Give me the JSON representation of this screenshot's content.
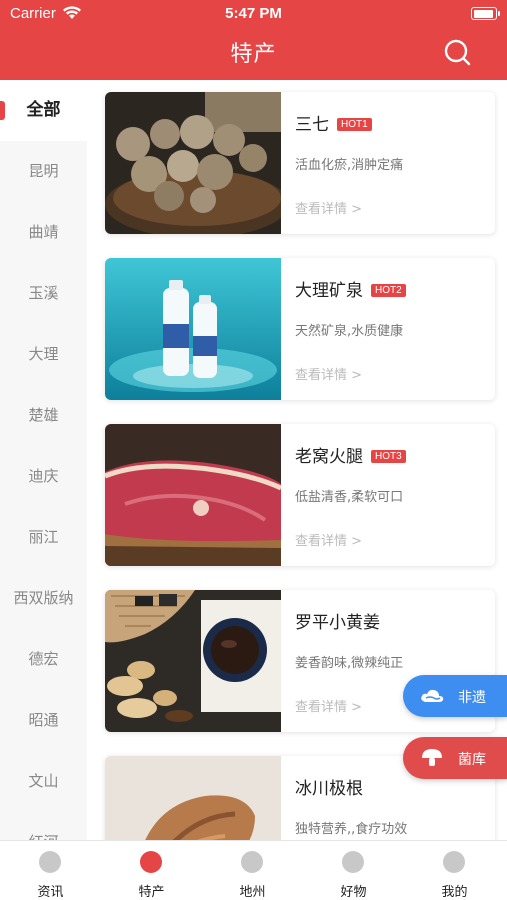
{
  "status_bar": {
    "carrier": "Carrier",
    "time": "5:47 PM"
  },
  "header": {
    "title": "特产",
    "search_icon": "search-icon"
  },
  "sidebar": {
    "items": [
      {
        "label": "全部",
        "active": true
      },
      {
        "label": "昆明"
      },
      {
        "label": "曲靖"
      },
      {
        "label": "玉溪"
      },
      {
        "label": "大理"
      },
      {
        "label": "楚雄"
      },
      {
        "label": "迪庆"
      },
      {
        "label": "丽江"
      },
      {
        "label": "西双版纳"
      },
      {
        "label": "德宏"
      },
      {
        "label": "昭通"
      },
      {
        "label": "文山"
      },
      {
        "label": "红河"
      }
    ]
  },
  "products": [
    {
      "title": "三七",
      "badge": "HOT1",
      "desc": "活血化瘀,消肿定痛",
      "more": "查看详情 >"
    },
    {
      "title": "大理矿泉",
      "badge": "HOT2",
      "desc": "天然矿泉,水质健康",
      "more": "查看详情 >"
    },
    {
      "title": "老窝火腿",
      "badge": "HOT3",
      "desc": "低盐清香,柔软可口",
      "more": "查看详情 >"
    },
    {
      "title": "罗平小黄姜",
      "badge": "",
      "desc": "姜香韵味,微辣纯正",
      "more": "查看详情 >"
    },
    {
      "title": "冰川极根",
      "badge": "",
      "desc": "独特营养,,食疗功效",
      "more": ""
    }
  ],
  "floating": {
    "feiyi": {
      "label": "非遗",
      "icon": "cloud-icon",
      "color": "#3d8ef0"
    },
    "junku": {
      "label": "菌库",
      "icon": "mushroom-icon",
      "color": "#e04c4c"
    }
  },
  "tabbar": {
    "items": [
      {
        "label": "资讯",
        "icon": "news-icon"
      },
      {
        "label": "特产",
        "icon": "specialty-icon",
        "active": true
      },
      {
        "label": "地州",
        "icon": "location-icon"
      },
      {
        "label": "好物",
        "icon": "goods-icon"
      },
      {
        "label": "我的",
        "icon": "profile-icon"
      }
    ]
  },
  "colors": {
    "primary": "#e64545",
    "accent_blue": "#3d8ef0"
  }
}
